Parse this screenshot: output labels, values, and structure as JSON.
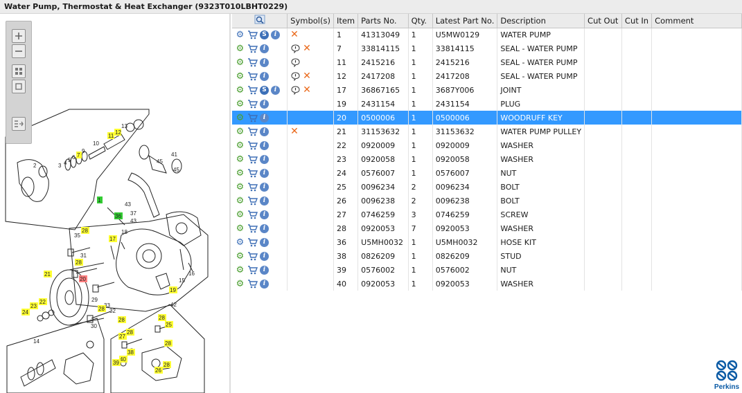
{
  "window": {
    "title": "Water Pump, Thermostat & Heat Exchanger (9323T010LBHT0229)"
  },
  "toolbar": {
    "icons": [
      "zoom-in-icon",
      "zoom-out-icon",
      "fit-page-icon",
      "actual-size-icon",
      "list-view-icon"
    ]
  },
  "diagram": {
    "highlight_labels": [
      "13",
      "12",
      "11",
      "7",
      "17",
      "28",
      "28",
      "28",
      "25",
      "28",
      "27",
      "28",
      "21",
      "22",
      "23",
      "24",
      "40",
      "39",
      "38",
      "26",
      "28",
      "19",
      "28",
      "28"
    ],
    "selected_label": "20",
    "green_labels": [
      "1",
      "36"
    ],
    "plain_labels": [
      "2",
      "3",
      "4",
      "5",
      "6",
      "9",
      "10",
      "41",
      "45",
      "45",
      "43",
      "37",
      "43",
      "18",
      "35",
      "31",
      "16",
      "15",
      "42",
      "29",
      "33",
      "30",
      "14",
      "32"
    ]
  },
  "table": {
    "columns": [
      "",
      "Symbol(s)",
      "Item",
      "Parts No.",
      "Qty.",
      "Latest Part No.",
      "Description",
      "Cut Out",
      "Cut In",
      "Comment"
    ],
    "rows": [
      {
        "actions": [
          "gear-kit",
          "cart",
          "s",
          "info"
        ],
        "symbols": [
          "x"
        ],
        "item": "1",
        "part_no": "41313049",
        "qty": "1",
        "latest": "U5MW0129",
        "desc": "WATER PUMP"
      },
      {
        "actions": [
          "gear",
          "cart",
          "info"
        ],
        "symbols": [
          "bubble",
          "x"
        ],
        "item": "7",
        "part_no": "33814115",
        "qty": "1",
        "latest": "33814115",
        "desc": "SEAL - WATER PUMP"
      },
      {
        "actions": [
          "gear",
          "cart",
          "info"
        ],
        "symbols": [
          "bubble"
        ],
        "item": "11",
        "part_no": "2415216",
        "qty": "1",
        "latest": "2415216",
        "desc": "SEAL - WATER PUMP"
      },
      {
        "actions": [
          "gear",
          "cart",
          "info"
        ],
        "symbols": [
          "bubble",
          "x"
        ],
        "item": "12",
        "part_no": "2417208",
        "qty": "1",
        "latest": "2417208",
        "desc": "SEAL - WATER PUMP"
      },
      {
        "actions": [
          "gear",
          "cart",
          "s",
          "info"
        ],
        "symbols": [
          "bubble",
          "x"
        ],
        "item": "17",
        "part_no": "36867165",
        "qty": "1",
        "latest": "3687Y006",
        "desc": "JOINT"
      },
      {
        "actions": [
          "gear",
          "cart",
          "info"
        ],
        "symbols": [],
        "item": "19",
        "part_no": "2431154",
        "qty": "1",
        "latest": "2431154",
        "desc": "PLUG"
      },
      {
        "actions": [
          "gear",
          "cart",
          "info"
        ],
        "symbols": [],
        "item": "20",
        "part_no": "0500006",
        "qty": "1",
        "latest": "0500006",
        "desc": "WOODRUFF KEY",
        "selected": true
      },
      {
        "actions": [
          "gear",
          "cart",
          "info"
        ],
        "symbols": [
          "x"
        ],
        "item": "21",
        "part_no": "31153632",
        "qty": "1",
        "latest": "31153632",
        "desc": "WATER PUMP PULLEY"
      },
      {
        "actions": [
          "gear",
          "cart",
          "info"
        ],
        "symbols": [],
        "item": "22",
        "part_no": "0920009",
        "qty": "1",
        "latest": "0920009",
        "desc": "WASHER"
      },
      {
        "actions": [
          "gear",
          "cart",
          "info"
        ],
        "symbols": [],
        "item": "23",
        "part_no": "0920058",
        "qty": "1",
        "latest": "0920058",
        "desc": "WASHER"
      },
      {
        "actions": [
          "gear",
          "cart",
          "info"
        ],
        "symbols": [],
        "item": "24",
        "part_no": "0576007",
        "qty": "1",
        "latest": "0576007",
        "desc": "NUT"
      },
      {
        "actions": [
          "gear",
          "cart",
          "info"
        ],
        "symbols": [],
        "item": "25",
        "part_no": "0096234",
        "qty": "2",
        "latest": "0096234",
        "desc": "BOLT"
      },
      {
        "actions": [
          "gear",
          "cart",
          "info"
        ],
        "symbols": [],
        "item": "26",
        "part_no": "0096238",
        "qty": "2",
        "latest": "0096238",
        "desc": "BOLT"
      },
      {
        "actions": [
          "gear",
          "cart",
          "info"
        ],
        "symbols": [],
        "item": "27",
        "part_no": "0746259",
        "qty": "3",
        "latest": "0746259",
        "desc": "SCREW"
      },
      {
        "actions": [
          "gear",
          "cart",
          "info"
        ],
        "symbols": [],
        "item": "28",
        "part_no": "0920053",
        "qty": "7",
        "latest": "0920053",
        "desc": "WASHER"
      },
      {
        "actions": [
          "gear-kit",
          "cart",
          "info"
        ],
        "symbols": [],
        "item": "36",
        "part_no": "U5MH0032",
        "qty": "1",
        "latest": "U5MH0032",
        "desc": "HOSE KIT"
      },
      {
        "actions": [
          "gear",
          "cart",
          "info"
        ],
        "symbols": [],
        "item": "38",
        "part_no": "0826209",
        "qty": "1",
        "latest": "0826209",
        "desc": "STUD"
      },
      {
        "actions": [
          "gear",
          "cart",
          "info"
        ],
        "symbols": [],
        "item": "39",
        "part_no": "0576002",
        "qty": "1",
        "latest": "0576002",
        "desc": "NUT"
      },
      {
        "actions": [
          "gear",
          "cart",
          "info"
        ],
        "symbols": [],
        "item": "40",
        "part_no": "0920053",
        "qty": "1",
        "latest": "0920053",
        "desc": "WASHER"
      }
    ]
  },
  "brand": {
    "name": "Perkins",
    "color": "#0a5aa5"
  },
  "colors": {
    "selection": "#3399ff",
    "highlight": "#ffff33",
    "selected_label": "#ff8080",
    "green_label": "#33cc33"
  }
}
